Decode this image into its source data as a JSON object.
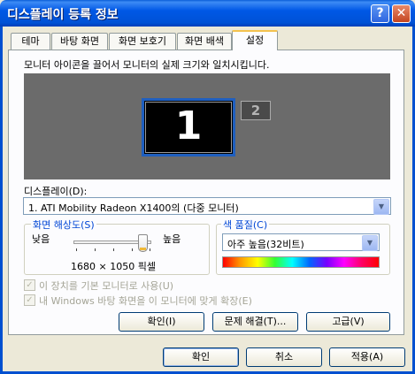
{
  "window": {
    "title": "디스플레이 등록 정보",
    "help_label": "?",
    "close_label": "✕"
  },
  "tabs": [
    {
      "label": "테마",
      "active": false
    },
    {
      "label": "바탕 화면",
      "active": false
    },
    {
      "label": "화면 보호기",
      "active": false
    },
    {
      "label": "화면 배색",
      "active": false
    },
    {
      "label": "설정",
      "active": true
    }
  ],
  "settings": {
    "instruction": "모니터 아이콘을 끌어서 모니터의 실제 크기와 일치시킵니다.",
    "monitors": {
      "primary": "1",
      "secondary": "2"
    },
    "display_label": "디스플레이(D):",
    "display_value": "1. ATI Mobility Radeon X1400의 (다중 모니터)",
    "resolution": {
      "group_label": "화면 해상도(S)",
      "low_label": "낮음",
      "high_label": "높음",
      "value_text": "1680 × 1050 픽셀",
      "slider_level": 1.0
    },
    "color_quality": {
      "group_label": "색 품질(C)",
      "value": "아주 높음(32비트)"
    },
    "checkboxes": [
      {
        "label": "이 장치를 기본 모니터로 사용(U)",
        "checked": true,
        "enabled": false
      },
      {
        "label": "내 Windows 바탕 화면을 이 모니터에 맞게 확장(E)",
        "checked": true,
        "enabled": false
      }
    ],
    "buttons": {
      "identify": "확인(I)",
      "troubleshoot": "문제 해결(T)...",
      "advanced": "고급(V)"
    }
  },
  "footer": {
    "ok": "확인",
    "cancel": "취소",
    "apply": "적용(A)"
  },
  "colors": {
    "titlebar": "#0058e6",
    "accent_label": "#0046d5",
    "tab_highlight": "#f4c24e",
    "monitor_border": "#1f5fbf"
  }
}
